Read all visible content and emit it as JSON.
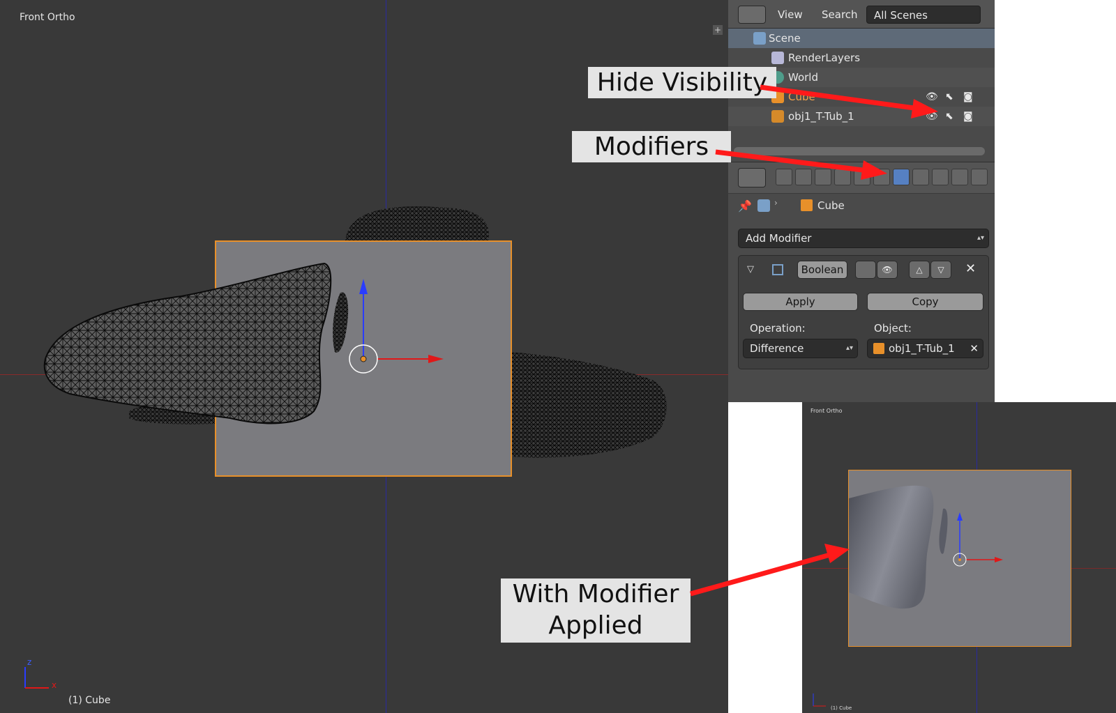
{
  "viewport": {
    "title": "Front Ortho",
    "status": "(1) Cube",
    "axis_z": "z",
    "axis_x": "x"
  },
  "outliner": {
    "menu_view": "View",
    "menu_search": "Search",
    "scene_filter": "All Scenes",
    "items": [
      {
        "label": "Scene"
      },
      {
        "label": "RenderLayers"
      },
      {
        "label": "World"
      },
      {
        "label": "Cube"
      },
      {
        "label": "obj1_T-Tub_1"
      }
    ]
  },
  "properties": {
    "context_object": "Cube",
    "add_modifier": "Add Modifier",
    "modifier_name": "Boolean",
    "apply_label": "Apply",
    "copy_label": "Copy",
    "operation_label": "Operation:",
    "operation_value": "Difference",
    "object_label": "Object:",
    "object_value": "obj1_T-Tub_1"
  },
  "preview": {
    "title": "Front Ortho",
    "status": "(1) Cube"
  },
  "callouts": {
    "hide_visibility": "Hide Visibility",
    "modifiers": "Modifiers",
    "with_modifier_line1": "With Modifier",
    "with_modifier_line2": "Applied"
  },
  "colors": {
    "viewport_bg": "#393939",
    "panel_bg": "#4a4a4a",
    "selection_orange": "#e8902a",
    "active_tab_blue": "#5680c2",
    "arrow_red": "#ff1a1a"
  }
}
